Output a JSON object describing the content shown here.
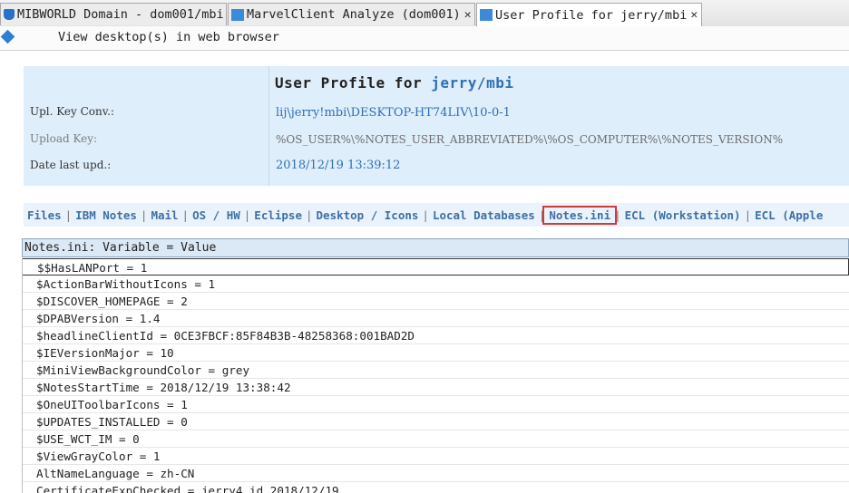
{
  "tabs": [
    {
      "label": "MIBWORLD Domain - dom001/mbi",
      "icon": "database-icon"
    },
    {
      "label": "MarvelClient Analyze (dom001)",
      "icon": "marvelclient-icon"
    },
    {
      "label": "User Profile for jerry/mbi",
      "icon": "marvelclient-doc-icon",
      "active": true
    }
  ],
  "toolbar": {
    "action": "View desktop(s) in web browser"
  },
  "profile": {
    "title_prefix": "User Profile for",
    "title_user": "jerry/mbi",
    "fields": [
      {
        "label": "Upl. Key Conv.:",
        "value": "lij\\jerry!mbi\\DESKTOP-HT74LIV\\10-0-1"
      },
      {
        "label": "Upload Key:",
        "value": "%OS_USER%\\%NOTES_USER_ABBREVIATED%\\%OS_COMPUTER%\\%NOTES_VERSION%"
      },
      {
        "label": "Date last upd.:",
        "value": "2018/12/19 13:39:12"
      }
    ]
  },
  "subtabs": [
    "Files",
    "IBM Notes",
    "Mail",
    "OS / HW",
    "Eclipse",
    "Desktop / Icons",
    "Local Databases",
    "Notes.ini",
    "ECL (Workstation)",
    "ECL (Apple"
  ],
  "selected_subtab": "Notes.ini",
  "table": {
    "header": "Notes.ini: Variable = Value",
    "rows": [
      "$$HasLANPort = 1",
      "$ActionBarWithoutIcons = 1",
      "$DISCOVER_HOMEPAGE = 2",
      "$DPABVersion = 1.4",
      "$headlineClientId = 0CE3FBCF:85F84B3B-48258368:001BAD2D",
      "$IEVersionMajor = 10",
      "$MiniViewBackgroundColor = grey",
      "$NotesStartTime = 2018/12/19 13:38:42",
      "$OneUIToolbarIcons = 1",
      "$UPDATES_INSTALLED = 0",
      "$USE_WCT_IM = 0",
      "$ViewGrayColor = 1",
      "AltNameLanguage = zh-CN",
      "CertificateExpChecked = jerry4.id 2018/12/19"
    ]
  },
  "colors": {
    "accent": "#2f6fb5",
    "highlight": "#d23a3a",
    "panel": "#dfeefb"
  }
}
